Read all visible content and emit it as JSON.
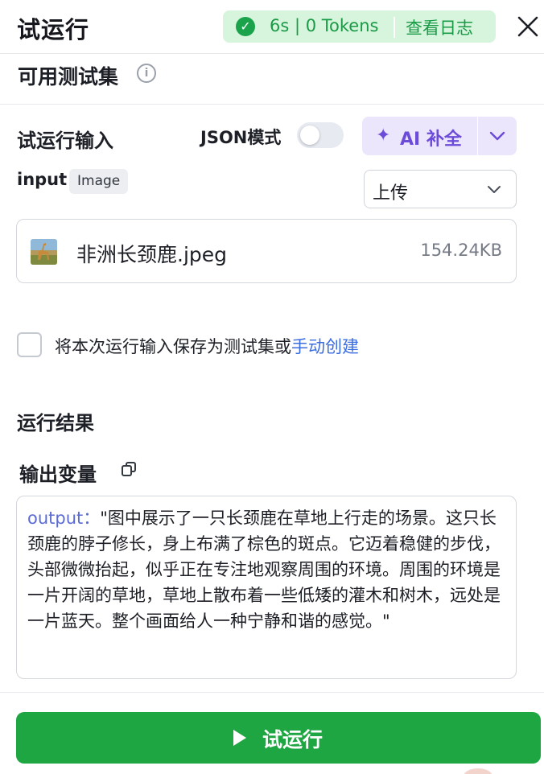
{
  "header": {
    "title": "试运行",
    "run_stats": "6s | 0 Tokens",
    "view_log_label": "查看日志"
  },
  "testset": {
    "label": "可用测试集"
  },
  "run_input": {
    "label": "试运行输入",
    "json_mode_label": "JSON模式",
    "json_mode_on": false,
    "ai_complete_label": "AI 补全",
    "input_name": "input",
    "input_type": "Image",
    "upload_mode": "上传",
    "file": {
      "name": "非洲长颈鹿.jpeg",
      "size": "154.24KB"
    },
    "save_prefix": "将本次运行输入保存为测试集或",
    "manual_create_label": "手动创建"
  },
  "result": {
    "section_label": "运行结果",
    "output_var_label": "输出变量",
    "output_key": "output：",
    "output_value": "\"图中展示了一只长颈鹿在草地上行走的场景。这只长颈鹿的脖子修长，身上布满了棕色的斑点。它迈着稳健的步伐，头部微微抬起，似乎正在专注地观察周围的环境。周围的环境是一片开阔的草地，草地上散布着一些低矮的灌木和树木，远处是一片蓝天。整个画面给人一种宁静和谐的感觉。\""
  },
  "footer": {
    "run_button_label": "试运行"
  },
  "colors": {
    "status_green": "#1aa34a",
    "status_bg": "#d6f5dc",
    "ai_purple": "#6b4bd8",
    "link_blue": "#3b6ce0",
    "run_button": "#1ea642"
  }
}
